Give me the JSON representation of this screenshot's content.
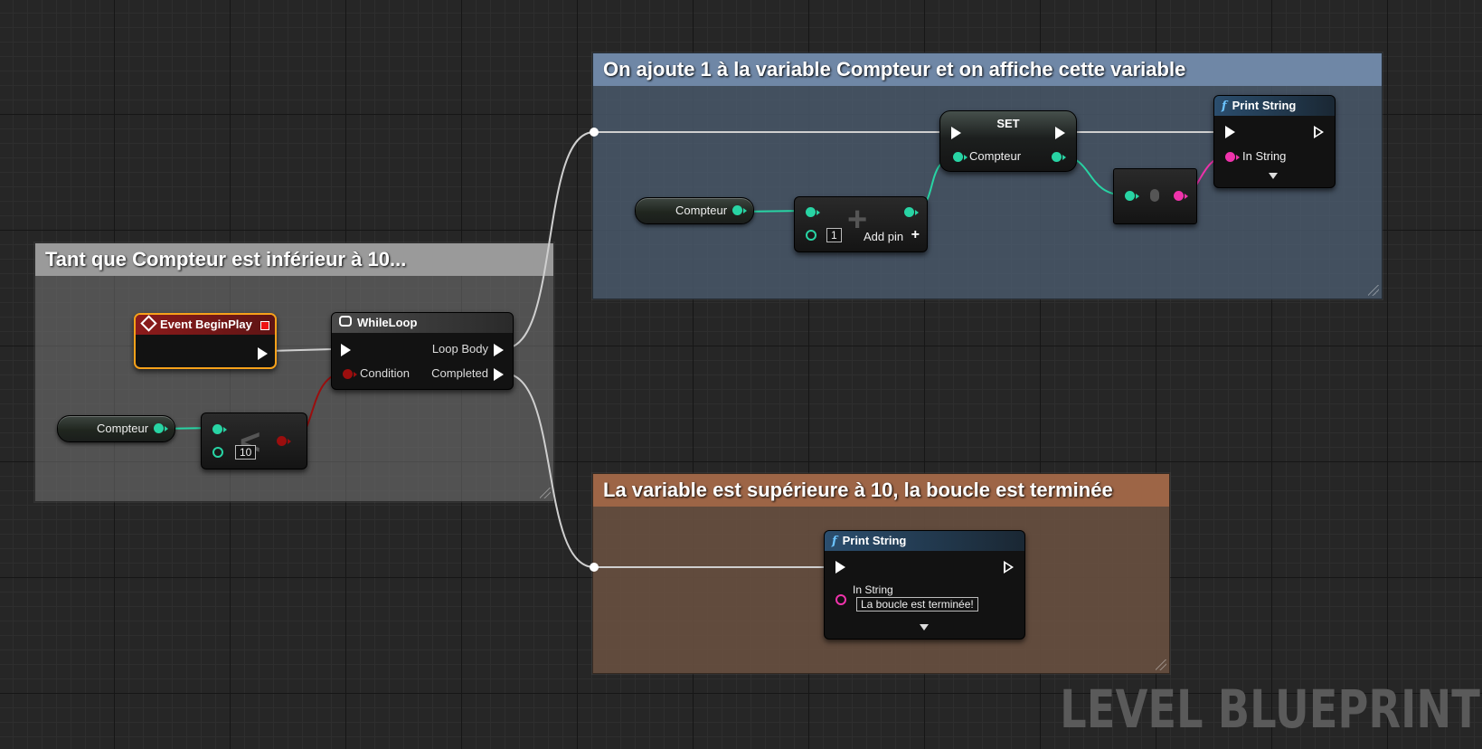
{
  "comments": {
    "while_loop": "Tant que Compteur est inférieur à 10...",
    "add_and_print": "On ajoute 1 à la variable Compteur et on affiche cette variable",
    "loop_end": "La variable est supérieure à 10, la boucle est terminée"
  },
  "nodes": {
    "event_begin_play": {
      "title": "Event BeginPlay"
    },
    "while_loop": {
      "title": "WhileLoop",
      "loop_body": "Loop Body",
      "condition": "Condition",
      "completed": "Completed"
    },
    "compteur_get_1": {
      "label": "Compteur"
    },
    "less_than": {
      "operator": "<",
      "value": "10"
    },
    "compteur_get_2": {
      "label": "Compteur"
    },
    "add": {
      "operator": "+",
      "value": "1",
      "add_pin": "Add pin"
    },
    "set": {
      "title": "SET",
      "var": "Compteur"
    },
    "print_string_1": {
      "title": "Print String",
      "in_string": "In String"
    },
    "print_string_2": {
      "title": "Print String",
      "in_string": "In String",
      "value": "La boucle est terminée!"
    }
  },
  "watermark": "LEVEL BLUEPRINT",
  "colors": {
    "exec": "#ffffff",
    "int_pin": "#28d4a4",
    "bool_pin": "#9b0e0e",
    "string_pin": "#f033ac",
    "event_border": "#f7a11a",
    "event_header": "#8c1b1b",
    "function_header": "#2b4e6e"
  }
}
